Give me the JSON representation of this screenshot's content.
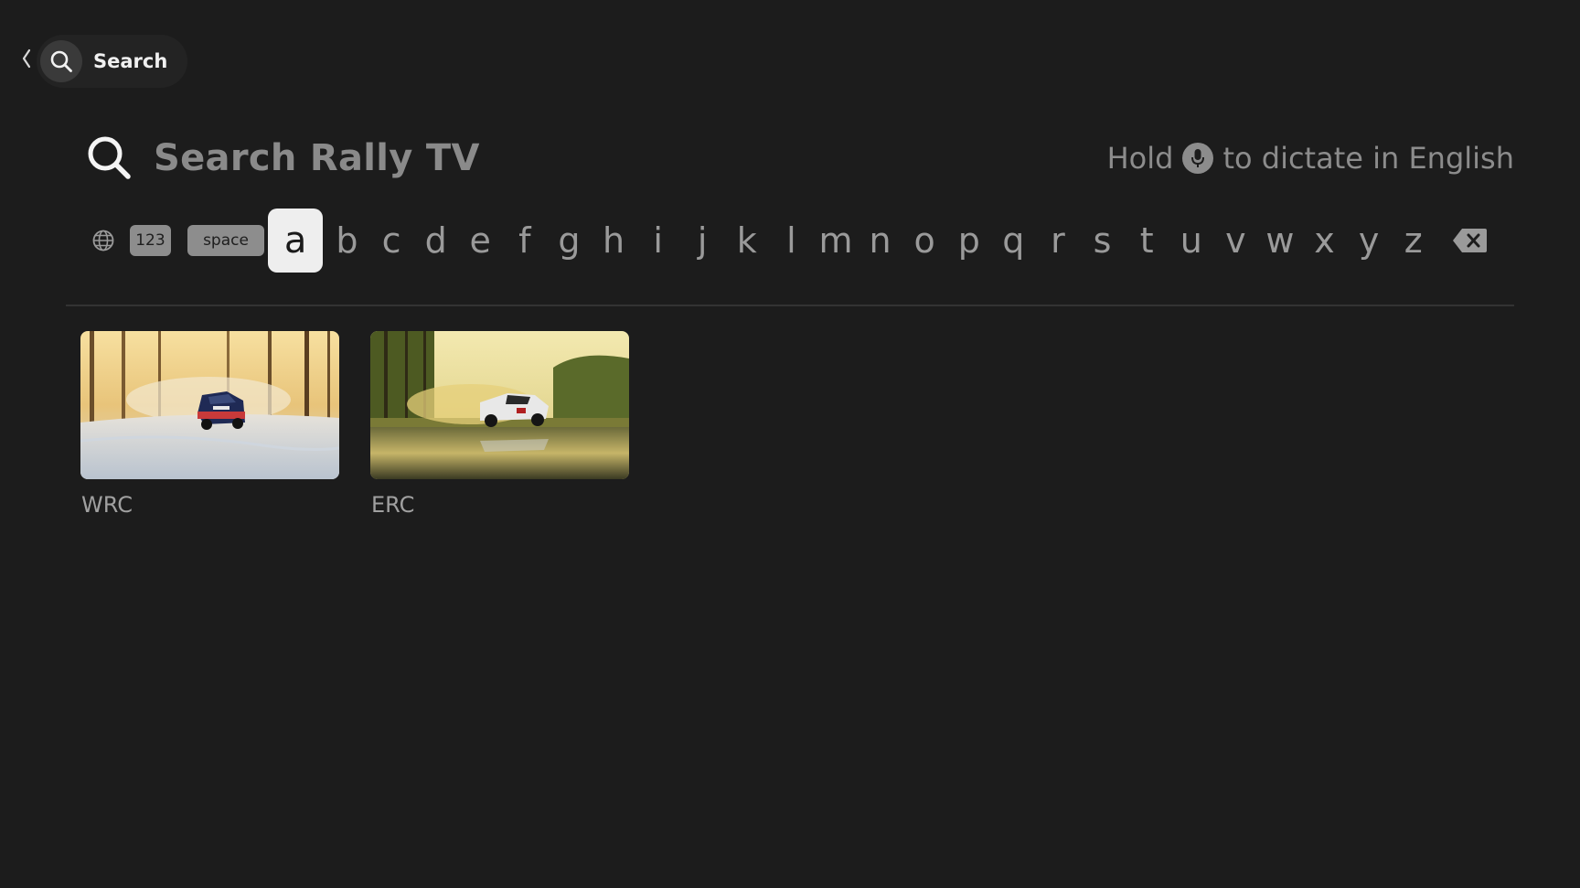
{
  "nav": {
    "back_icon": "chevron-left-icon",
    "search_icon": "search-icon",
    "label": "Search"
  },
  "search": {
    "placeholder": "Search Rally TV",
    "icon": "search-icon"
  },
  "dictation": {
    "prefix": "Hold",
    "mic_icon": "microphone-icon",
    "suffix": "to dictate in English"
  },
  "keyboard": {
    "globe_icon": "globe-icon",
    "numbers_key": "123",
    "space_key": "space",
    "focused_letter": "a",
    "letters": [
      "a",
      "b",
      "c",
      "d",
      "e",
      "f",
      "g",
      "h",
      "i",
      "j",
      "k",
      "l",
      "m",
      "n",
      "o",
      "p",
      "q",
      "r",
      "s",
      "t",
      "u",
      "v",
      "w",
      "x",
      "y",
      "z"
    ],
    "delete_icon": "backspace-icon"
  },
  "results": [
    {
      "title": "WRC"
    },
    {
      "title": "ERC"
    }
  ],
  "colors": {
    "background": "#1c1c1c",
    "focused_key": "#eeeeee",
    "text_dim": "#8a8a8a"
  }
}
